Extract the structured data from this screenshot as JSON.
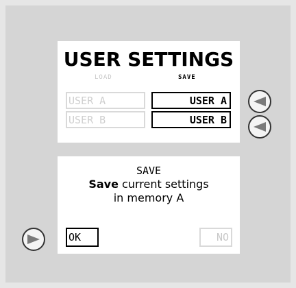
{
  "user_settings": {
    "title": "USER SETTINGS",
    "load_label": "LOAD",
    "save_label": "SAVE",
    "load_slots": [
      "USER A",
      "USER B"
    ],
    "save_slots": [
      "USER A",
      "USER B"
    ]
  },
  "dialog": {
    "title": "SAVE",
    "line1_bold": "Save",
    "line1_rest": " current settings",
    "line2": "in memory A",
    "ok_label": "OK",
    "no_label": "NO"
  },
  "icons": {
    "left_arrow": "arrow-left-icon",
    "right_arrow": "arrow-right-icon"
  }
}
